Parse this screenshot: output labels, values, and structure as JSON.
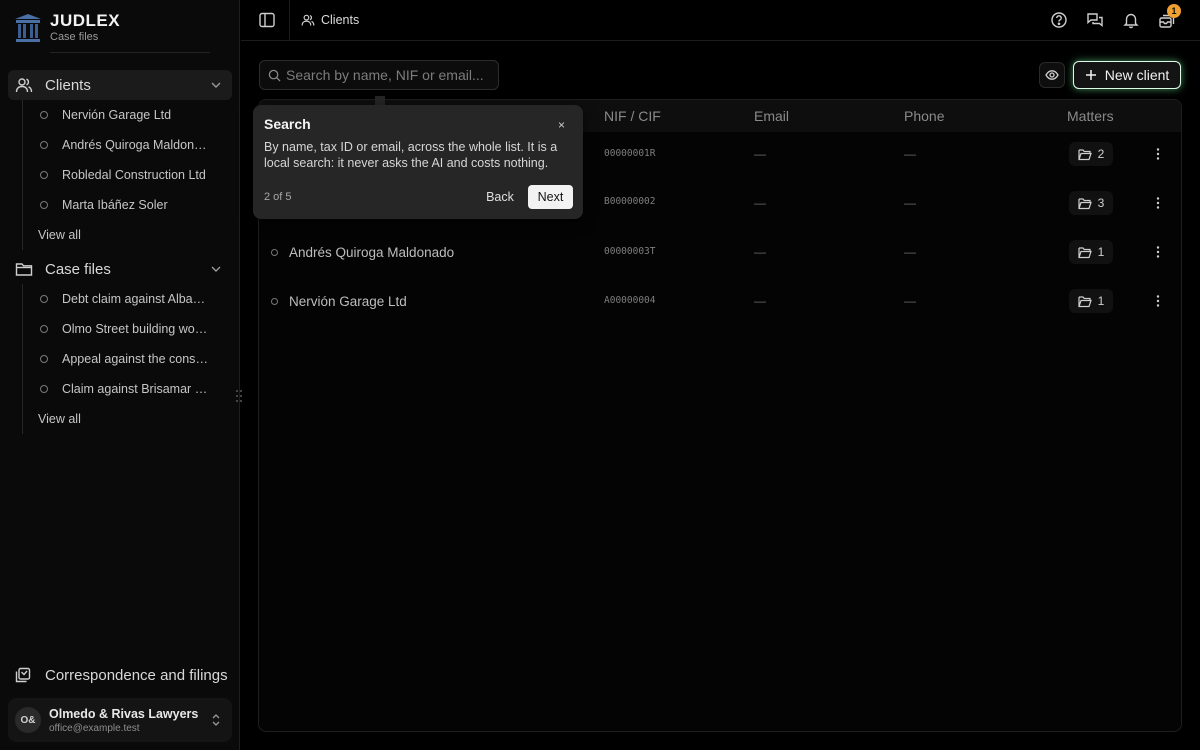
{
  "brand": {
    "title": "JUDLEX",
    "subtitle": "Case files"
  },
  "sidebar": {
    "clients": {
      "label": "Clients",
      "items": [
        "Nervión Garage Ltd",
        "Andrés Quiroga Maldonado",
        "Robledal Construction Ltd",
        "Marta Ibáñez Soler"
      ],
      "view_all": "View all"
    },
    "case_files": {
      "label": "Case files",
      "items": [
        "Debt claim against Albarrán Logistics",
        "Olmo Street building works",
        "Appeal against the construction licence",
        "Claim against Brisamar Insurance"
      ],
      "view_all": "View all"
    },
    "correspondence": "Correspondence and filings",
    "org": {
      "initials": "O&",
      "name": "Olmedo & Rivas Lawyers",
      "email": "office@example.test"
    }
  },
  "topbar": {
    "breadcrumb": "Clients",
    "notification_count": "1"
  },
  "main": {
    "search_placeholder": "Search by name, NIF or email...",
    "new_client_label": "New client",
    "columns": {
      "nif": "NIF / CIF",
      "email": "Email",
      "phone": "Phone",
      "matters": "Matters"
    },
    "rows": [
      {
        "name": "",
        "nif": "00000001R",
        "email": "—",
        "phone": "—",
        "matters": "2"
      },
      {
        "name": "",
        "nif": "B00000002",
        "email": "—",
        "phone": "—",
        "matters": "3"
      },
      {
        "name": "Andrés Quiroga Maldonado",
        "nif": "00000003T",
        "email": "—",
        "phone": "—",
        "matters": "1"
      },
      {
        "name": "Nervión Garage Ltd",
        "nif": "A00000004",
        "email": "—",
        "phone": "—",
        "matters": "1"
      }
    ]
  },
  "tour": {
    "title": "Search",
    "close": "×",
    "body": "By name, tax ID or email, across the whole list. It is a local search: it never asks the AI and costs nothing.",
    "step": "2 of 5",
    "back": "Back",
    "next": "Next"
  },
  "colors": {
    "accent_glow": "#78ffaa",
    "badge": "#f0a030"
  }
}
